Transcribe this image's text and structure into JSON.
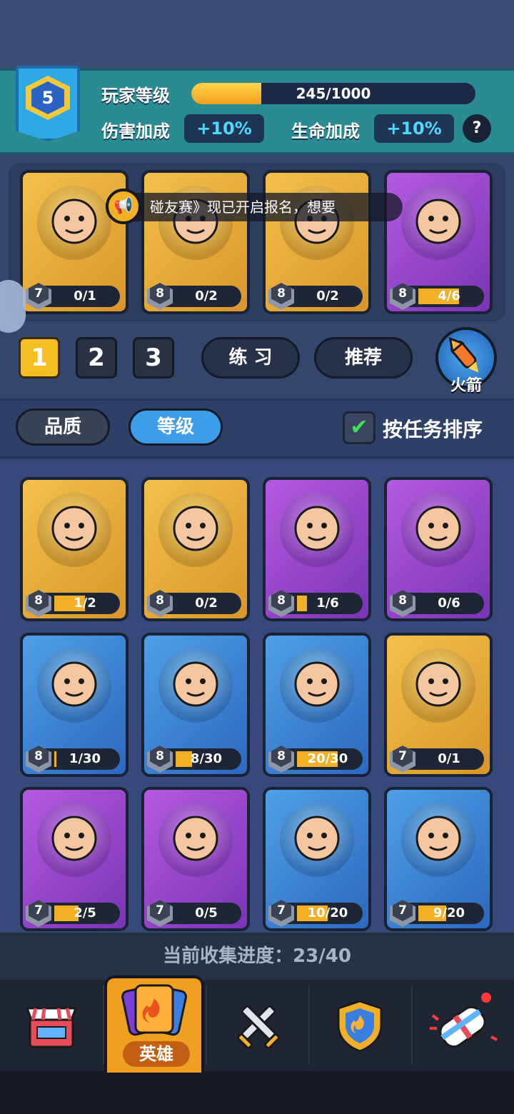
{
  "player": {
    "level": "5",
    "level_label": "玩家等级",
    "xp_text": "245/1000",
    "xp_progress": 0.245,
    "damage_label": "伤害加成",
    "damage_value": "+10%",
    "hp_label": "生命加成",
    "hp_value": "+10%",
    "help": "?"
  },
  "ticker": {
    "text": "碰友赛》现已开启报名，想要"
  },
  "team": [
    {
      "level": "7",
      "progress": "0/1",
      "fill": 0.0,
      "rarity": "gold",
      "name_icon": "cloud-hero-icon"
    },
    {
      "level": "8",
      "progress": "0/2",
      "fill": 0.0,
      "rarity": "gold",
      "name_icon": "pink-hair-hero-icon"
    },
    {
      "level": "8",
      "progress": "0/2",
      "fill": 0.0,
      "rarity": "gold",
      "name_icon": "old-dwarf-hero-icon"
    },
    {
      "level": "8",
      "progress": "4/6",
      "fill": 0.667,
      "rarity": "purple",
      "name_icon": "straw-hat-ninja-icon"
    }
  ],
  "team_tabs": [
    "1",
    "2",
    "3"
  ],
  "buttons": {
    "practice": "练 习",
    "recommend": "推荐",
    "rocket": "火箭"
  },
  "sort": {
    "quality": "品质",
    "level": "等级",
    "by_task": "按任务排序"
  },
  "heroes": [
    {
      "level": "8",
      "progress": "1/2",
      "fill": 0.5,
      "rarity": "gold",
      "icon": "knight-hero-icon"
    },
    {
      "level": "8",
      "progress": "0/2",
      "fill": 0.0,
      "rarity": "gold",
      "icon": "fox-priestess-icon"
    },
    {
      "level": "8",
      "progress": "1/6",
      "fill": 0.167,
      "rarity": "purple",
      "icon": "bull-warrior-icon"
    },
    {
      "level": "8",
      "progress": "0/6",
      "fill": 0.0,
      "rarity": "purple",
      "icon": "banana-ape-icon"
    },
    {
      "level": "8",
      "progress": "1/30",
      "fill": 0.033,
      "rarity": "blue",
      "icon": "viking-dwarf-icon"
    },
    {
      "level": "8",
      "progress": "8/30",
      "fill": 0.267,
      "rarity": "blue",
      "icon": "spartan-hero-icon"
    },
    {
      "level": "8",
      "progress": "20/30",
      "fill": 0.667,
      "rarity": "blue",
      "icon": "tribal-brute-icon"
    },
    {
      "level": "7",
      "progress": "0/1",
      "fill": 0.0,
      "rarity": "gold",
      "icon": "spider-hero-icon"
    },
    {
      "level": "7",
      "progress": "2/5",
      "fill": 0.4,
      "rarity": "purple",
      "icon": "hook-ogre-icon"
    },
    {
      "level": "7",
      "progress": "0/5",
      "fill": 0.0,
      "rarity": "purple",
      "icon": "tiger-pirate-icon"
    },
    {
      "level": "7",
      "progress": "10/20",
      "fill": 0.5,
      "rarity": "blue",
      "icon": "bird-trio-icon"
    },
    {
      "level": "7",
      "progress": "9/20",
      "fill": 0.45,
      "rarity": "blue",
      "icon": "pirate-brute-icon"
    }
  ],
  "collection": {
    "text": "当前收集进度：23/40"
  },
  "nav": {
    "items": [
      {
        "icon": "shop-icon"
      },
      {
        "icon": "hero-cards-icon",
        "label": "英雄"
      },
      {
        "icon": "crossed-swords-icon"
      },
      {
        "icon": "clan-shield-icon"
      },
      {
        "icon": "gift-capsule-icon"
      }
    ]
  },
  "colors": {
    "gold": "#f2b027",
    "purple": "#9a47d0",
    "blue": "#3f86d6",
    "accent_cyan": "#4fd8ff"
  }
}
